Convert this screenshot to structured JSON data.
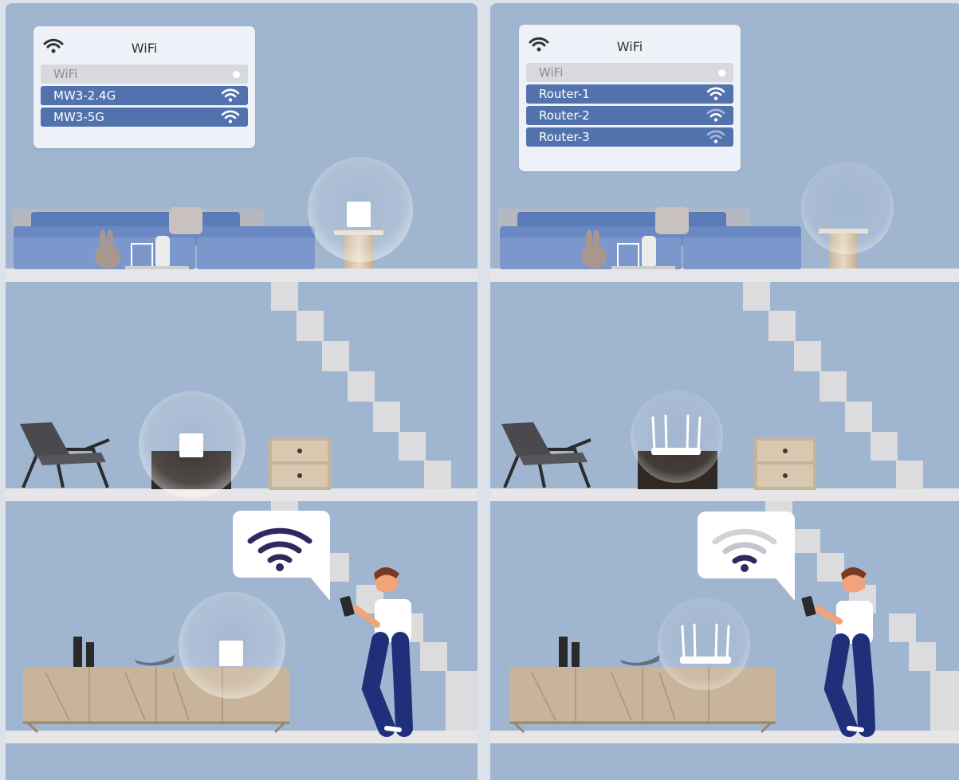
{
  "colors": {
    "background": "#a0b5cf",
    "accent": "#5272ad",
    "speech_wifi_mesh": "#2f2a5e",
    "speech_wifi_router_partial": "#c9cbd1"
  },
  "left_panel": {
    "card": {
      "title": "WiFi",
      "toggle_label": "WiFi",
      "networks": [
        {
          "name": "MW3-2.4G",
          "signal": "full"
        },
        {
          "name": "MW3-5G",
          "signal": "full"
        }
      ]
    },
    "device_type": "mesh node",
    "phone_signal": "full"
  },
  "right_panel": {
    "card": {
      "title": "WiFi",
      "toggle_label": "WiFi",
      "networks": [
        {
          "name": "Router-1",
          "signal": "full"
        },
        {
          "name": "Router-2",
          "signal": "medium"
        },
        {
          "name": "Router-3",
          "signal": "weak"
        }
      ]
    },
    "device_type": "router",
    "phone_signal": "weak"
  }
}
